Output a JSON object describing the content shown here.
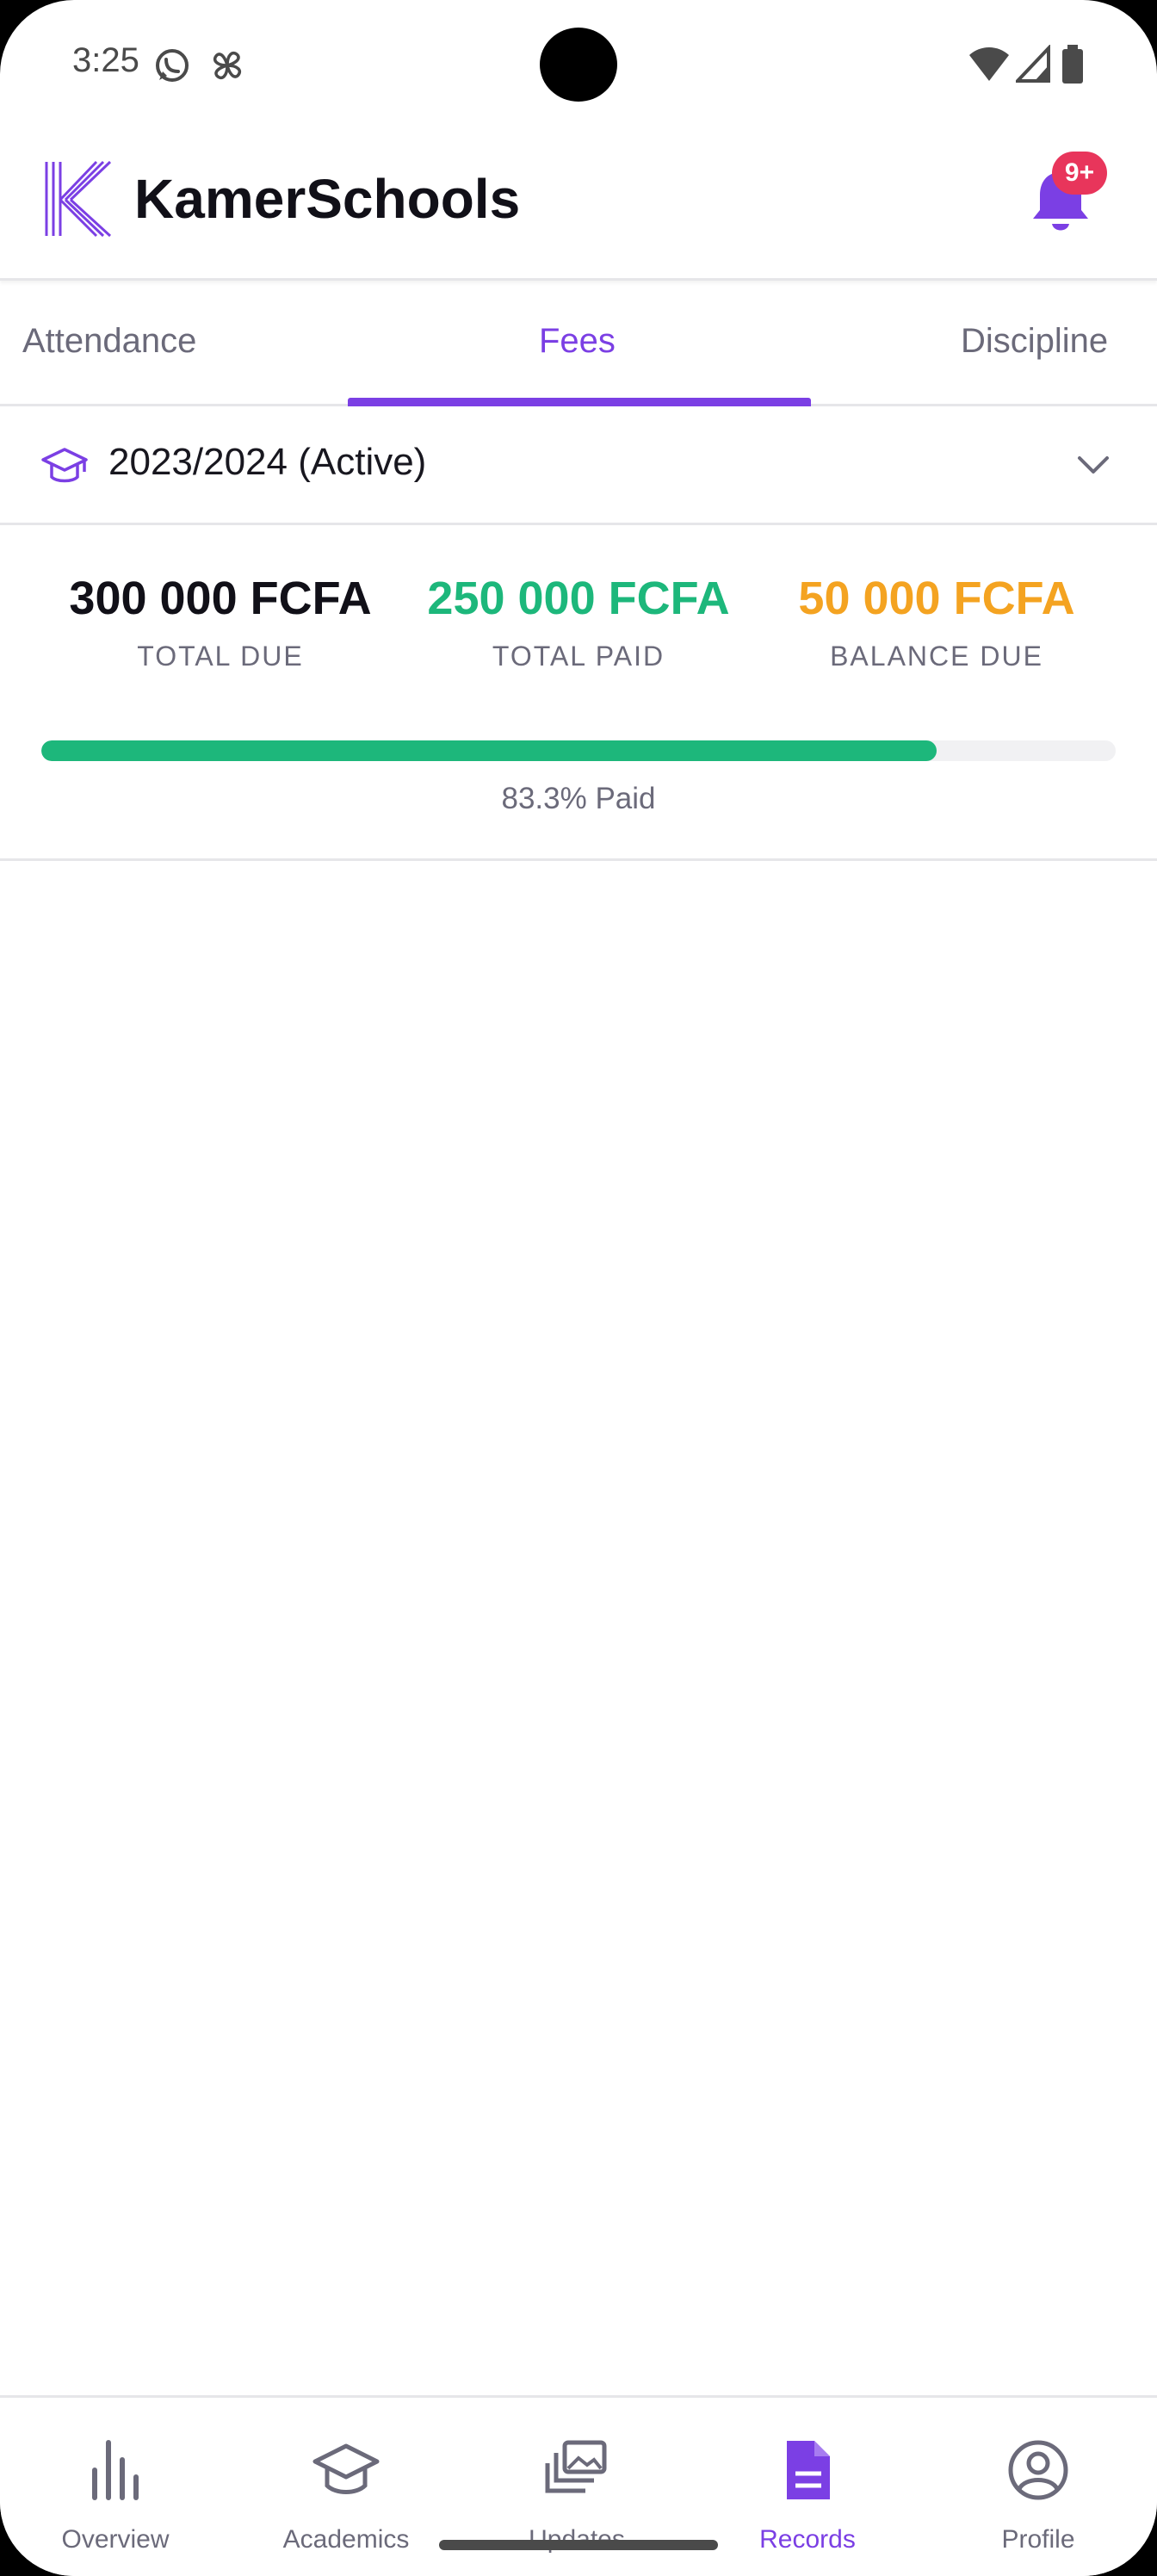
{
  "status_bar": {
    "time": "3:25"
  },
  "app": {
    "title": "KamerSchools",
    "notification_badge": "9+"
  },
  "tabs": [
    {
      "label": "Attendance",
      "active": false
    },
    {
      "label": "Fees",
      "active": true
    },
    {
      "label": "Discipline",
      "active": false
    }
  ],
  "year_selector": {
    "label": "2023/2024 (Active)"
  },
  "summary": {
    "total_due": {
      "value": "300 000 FCFA",
      "label": "TOTAL DUE"
    },
    "total_paid": {
      "value": "250 000 FCFA",
      "label": "TOTAL PAID"
    },
    "balance_due": {
      "value": "50 000 FCFA",
      "label": "BALANCE DUE"
    },
    "progress_fraction": 0.833,
    "progress_text": "83.3% Paid"
  },
  "bottom_nav": [
    {
      "label": "Overview",
      "icon": "bar-chart-icon",
      "active": false
    },
    {
      "label": "Academics",
      "icon": "graduation-cap-icon",
      "active": false
    },
    {
      "label": "Updates",
      "icon": "stacked-images-icon",
      "active": false
    },
    {
      "label": "Records",
      "icon": "document-icon",
      "active": true
    },
    {
      "label": "Profile",
      "icon": "user-circle-icon",
      "active": false
    }
  ],
  "colors": {
    "accent": "#7b3fe4",
    "paid": "#1db77b",
    "balance": "#f4a321",
    "due": "#111018",
    "badge": "#e8355b"
  }
}
